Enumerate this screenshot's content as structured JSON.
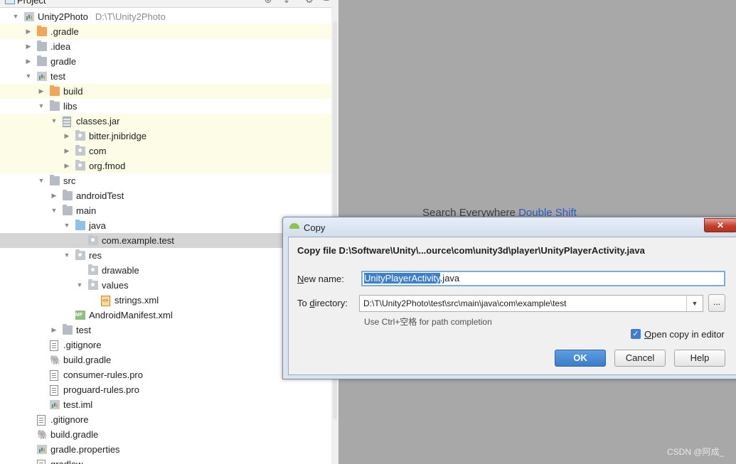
{
  "panel": {
    "title": "Project"
  },
  "tree": [
    {
      "label": "Unity2Photo",
      "hint": "D:\\T\\Unity2Photo",
      "level": 0,
      "arrow": "down",
      "icon": "module-icon",
      "state": ""
    },
    {
      "label": ".gradle",
      "level": 1,
      "arrow": "right",
      "icon": "folder-orange-icon",
      "state": "hl"
    },
    {
      "label": ".idea",
      "level": 1,
      "arrow": "right",
      "icon": "folder-icon",
      "state": ""
    },
    {
      "label": "gradle",
      "level": 1,
      "arrow": "right",
      "icon": "folder-icon",
      "state": ""
    },
    {
      "label": "test",
      "level": 1,
      "arrow": "down",
      "icon": "module-icon",
      "state": ""
    },
    {
      "label": "build",
      "level": 2,
      "arrow": "right",
      "icon": "folder-orange-icon",
      "state": "hl"
    },
    {
      "label": "libs",
      "level": 2,
      "arrow": "down",
      "icon": "folder-icon",
      "state": ""
    },
    {
      "label": "classes.jar",
      "level": 3,
      "arrow": "down",
      "icon": "jar-icon",
      "state": "hl"
    },
    {
      "label": "bitter.jnibridge",
      "level": 4,
      "arrow": "right",
      "icon": "package-icon",
      "state": "hl"
    },
    {
      "label": "com",
      "level": 4,
      "arrow": "right",
      "icon": "package-icon",
      "state": "hl"
    },
    {
      "label": "org.fmod",
      "level": 4,
      "arrow": "right",
      "icon": "package-icon",
      "state": "hl"
    },
    {
      "label": "src",
      "level": 2,
      "arrow": "down",
      "icon": "folder-icon",
      "state": ""
    },
    {
      "label": "androidTest",
      "level": 3,
      "arrow": "right",
      "icon": "folder-icon",
      "state": ""
    },
    {
      "label": "main",
      "level": 3,
      "arrow": "down",
      "icon": "folder-icon",
      "state": ""
    },
    {
      "label": "java",
      "level": 4,
      "arrow": "down",
      "icon": "folder-blue-icon",
      "state": ""
    },
    {
      "label": "com.example.test",
      "level": 5,
      "arrow": "",
      "icon": "package-icon",
      "state": "sel"
    },
    {
      "label": "res",
      "level": 4,
      "arrow": "down",
      "icon": "res-folder-icon",
      "state": ""
    },
    {
      "label": "drawable",
      "level": 5,
      "arrow": "",
      "icon": "package-icon",
      "state": ""
    },
    {
      "label": "values",
      "level": 5,
      "arrow": "down",
      "icon": "package-icon",
      "state": ""
    },
    {
      "label": "strings.xml",
      "level": 6,
      "arrow": "",
      "icon": "xml-icon",
      "state": ""
    },
    {
      "label": "AndroidManifest.xml",
      "level": 4,
      "arrow": "",
      "icon": "manifest-icon",
      "state": ""
    },
    {
      "label": "test",
      "level": 3,
      "arrow": "right",
      "icon": "folder-icon",
      "state": ""
    },
    {
      "label": ".gitignore",
      "level": 2,
      "arrow": "",
      "icon": "file-icon",
      "state": ""
    },
    {
      "label": "build.gradle",
      "level": 2,
      "arrow": "",
      "icon": "gradle-icon",
      "state": ""
    },
    {
      "label": "consumer-rules.pro",
      "level": 2,
      "arrow": "",
      "icon": "file-icon",
      "state": ""
    },
    {
      "label": "proguard-rules.pro",
      "level": 2,
      "arrow": "",
      "icon": "file-icon",
      "state": ""
    },
    {
      "label": "test.iml",
      "level": 2,
      "arrow": "",
      "icon": "module-icon",
      "state": ""
    },
    {
      "label": ".gitignore",
      "level": 1,
      "arrow": "",
      "icon": "file-icon",
      "state": ""
    },
    {
      "label": "build.gradle",
      "level": 1,
      "arrow": "",
      "icon": "gradle-icon",
      "state": ""
    },
    {
      "label": "gradle.properties",
      "level": 1,
      "arrow": "",
      "icon": "module-icon",
      "state": ""
    },
    {
      "label": "gradlew",
      "level": 1,
      "arrow": "",
      "icon": "file-icon",
      "state": ""
    }
  ],
  "editor": {
    "search_text": "Search Everywhere",
    "search_shortcut": "Double Shift",
    "watermark": "CSDN @阿成_"
  },
  "dialog": {
    "title": "Copy",
    "close_label": "✕",
    "heading": "Copy file D:\\Software\\Unity\\...ource\\com\\unity3d\\player\\UnityPlayerActivity.java",
    "new_name_label": "New name:",
    "new_name_selected": "UnityPlayerActivity",
    "new_name_rest": ".java",
    "to_directory_label": "To directory:",
    "to_directory_value": "D:\\T\\Unity2Photo\\test\\src\\main\\java\\com\\example\\test",
    "browse_label": "...",
    "path_hint": "Use Ctrl+空格 for path completion",
    "open_copy_label": "Open copy in editor",
    "open_copy_checked": true,
    "ok_label": "OK",
    "cancel_label": "Cancel",
    "help_label": "Help"
  }
}
